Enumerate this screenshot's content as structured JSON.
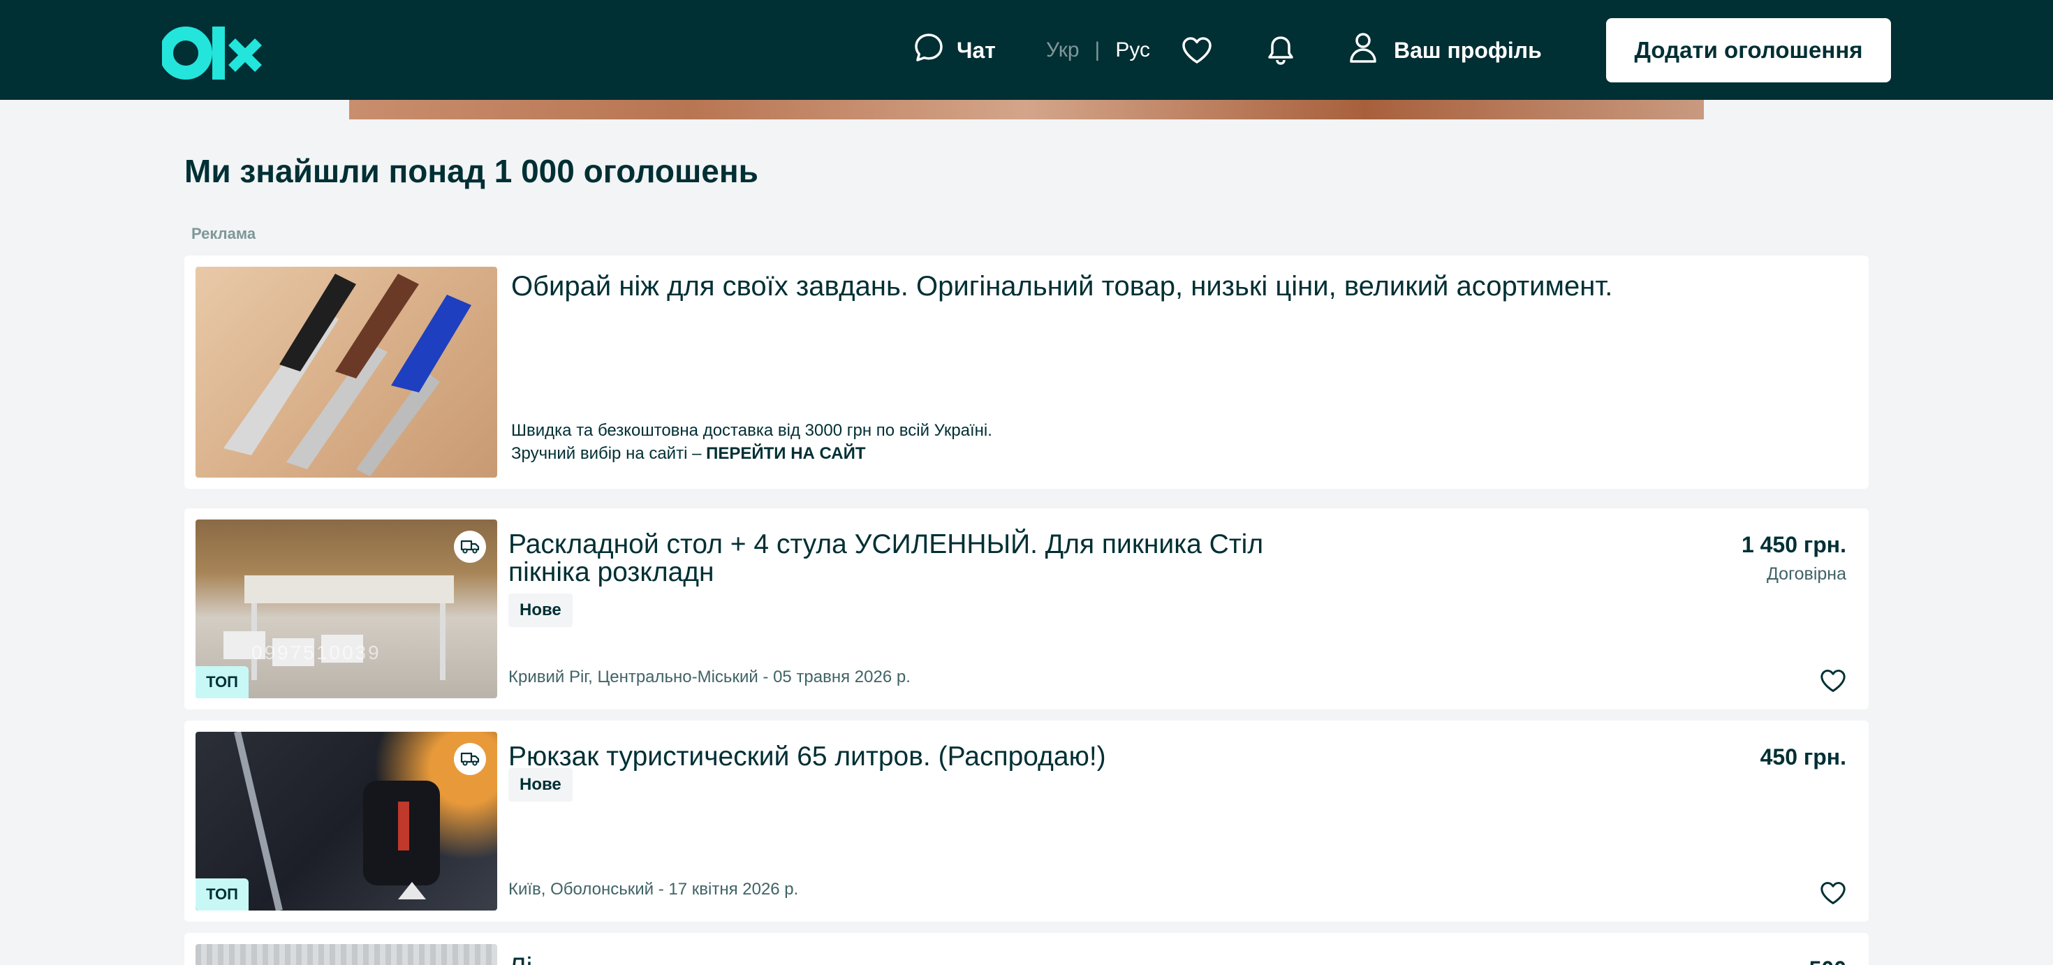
{
  "header": {
    "logo_text": "olx",
    "chat_label": "Чат",
    "lang_uk": "Укр",
    "lang_separator": "|",
    "lang_ru": "Рус",
    "profile_label": "Ваш профіль",
    "add_button_label": "Додати оголошення",
    "colors": {
      "background": "#002f34",
      "logo": "#23e5db"
    }
  },
  "main": {
    "title": "Ми знайшли понад 1 000 оголошень",
    "ad_label": "Реклама"
  },
  "ad": {
    "title": "Обирай ніж для своїх завдань. Оригінальний товар, низькі ціни, великий асортимент.",
    "desc_line1": "Швидка та безкоштовна доставка від 3000 грн по всій Україні.",
    "desc_line2_prefix": "Зручний вибір на сайті – ",
    "desc_line2_link": "ПЕРЕЙТИ НА САЙТ"
  },
  "listings": [
    {
      "title": "Раскладной стол + 4 стула УСИЛЕННЫЙ. Для пикника Стіл пікніка розкладн",
      "condition": "Нове",
      "location_date": "Кривий Ріг, Центрально-Міський - 05 травня 2026 р.",
      "price": "1 450 грн.",
      "negotiable": "Договірна",
      "badge": "ТОП",
      "image_watermark": "0997510039"
    },
    {
      "title": "Рюкзак туристический 65 литров. (Распродаю!)",
      "condition": "Нове",
      "location_date": "Київ, Оболонський - 17 квітня 2026 р.",
      "price": "450 грн.",
      "badge": "ТОП"
    },
    {
      "title": "Лі",
      "price": "500"
    }
  ]
}
